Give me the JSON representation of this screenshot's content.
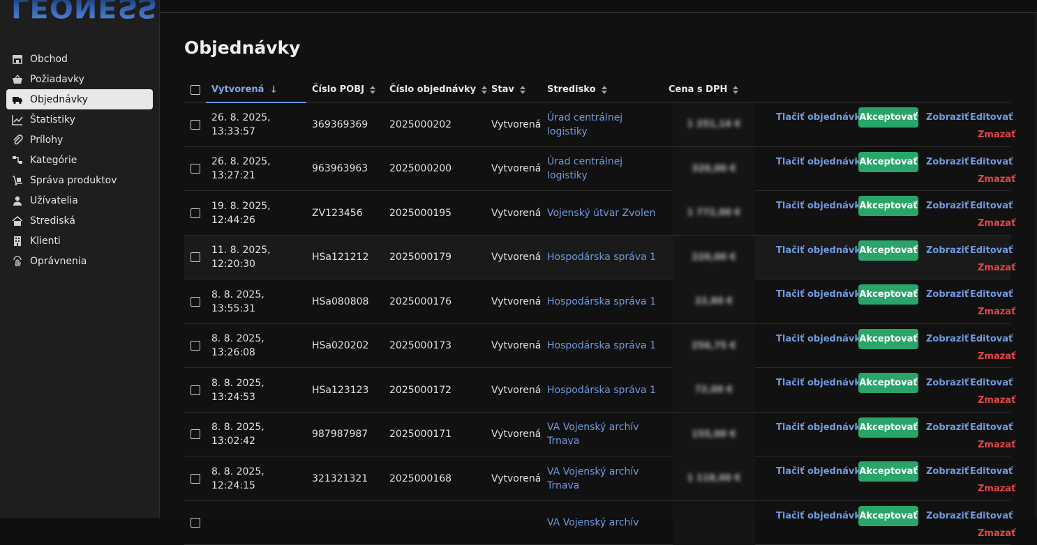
{
  "app": {
    "logo_text": "LEONESS"
  },
  "sidebar": {
    "items": [
      {
        "label": "Obchod",
        "icon": "store-icon",
        "active": false
      },
      {
        "label": "Požiadavky",
        "icon": "basket-icon",
        "active": false
      },
      {
        "label": "Objednávky",
        "icon": "truck-icon",
        "active": true
      },
      {
        "label": "Štatistiky",
        "icon": "chart-line-icon",
        "active": false
      },
      {
        "label": "Prílohy",
        "icon": "paperclip-icon",
        "active": false
      },
      {
        "label": "Kategórie",
        "icon": "sitemap-icon",
        "active": false
      },
      {
        "label": "Správa produktov",
        "icon": "dolly-icon",
        "active": false
      },
      {
        "label": "Užívatelia",
        "icon": "user-icon",
        "active": false
      },
      {
        "label": "Strediská",
        "icon": "house-user-icon",
        "active": false
      },
      {
        "label": "Klienti",
        "icon": "building-icon",
        "active": false
      },
      {
        "label": "Oprávnenia",
        "icon": "fingerprint-icon",
        "active": false
      }
    ]
  },
  "main": {
    "title": "Objednávky",
    "columns": {
      "created": "Vytvorená",
      "pobj": "Číslo POBJ",
      "order_number": "Číslo objednávky",
      "status": "Stav",
      "center": "Stredisko",
      "price": "Cena s DPH"
    },
    "actions": {
      "print": "Tlačiť objednávku",
      "accept": "Akceptovať",
      "view": "Zobraziť",
      "edit": "Editovať",
      "delete": "Zmazať"
    },
    "rows": [
      {
        "created": "26. 8. 2025, 13:33:57",
        "pobj": "369369369",
        "order_number": "2025000202",
        "status": "Vytvorená",
        "center": "Úrad centrálnej logistiky",
        "price": "1 251,14 €"
      },
      {
        "created": "26. 8. 2025, 13:27:21",
        "pobj": "963963963",
        "order_number": "2025000200",
        "status": "Vytvorená",
        "center": "Úrad centrálnej logistiky",
        "price": "320,00 €"
      },
      {
        "created": "19. 8. 2025, 12:44:26",
        "pobj": "ZV123456",
        "order_number": "2025000195",
        "status": "Vytvorená",
        "center": "Vojenský útvar Zvolen",
        "price": "1 772,00 €"
      },
      {
        "created": "11. 8. 2025, 12:20:30",
        "pobj": "HSa121212",
        "order_number": "2025000179",
        "status": "Vytvorená",
        "center": "Hospodárska správa 1",
        "price": "220,00 €"
      },
      {
        "created": "8. 8. 2025, 13:55:31",
        "pobj": "HSa080808",
        "order_number": "2025000176",
        "status": "Vytvorená",
        "center": "Hospodárska správa 1",
        "price": "22,80 €"
      },
      {
        "created": "8. 8. 2025, 13:26:08",
        "pobj": "HSa020202",
        "order_number": "2025000173",
        "status": "Vytvorená",
        "center": "Hospodárska správa 1",
        "price": "256,75 €"
      },
      {
        "created": "8. 8. 2025, 13:24:53",
        "pobj": "HSa123123",
        "order_number": "2025000172",
        "status": "Vytvorená",
        "center": "Hospodárska správa 1",
        "price": "72,00 €"
      },
      {
        "created": "8. 8. 2025, 13:02:42",
        "pobj": "987987987",
        "order_number": "2025000171",
        "status": "Vytvorená",
        "center": "VA Vojenský archív Trnava",
        "price": "155,00 €"
      },
      {
        "created": "8. 8. 2025, 12:24:15",
        "pobj": "321321321",
        "order_number": "2025000168",
        "status": "Vytvorená",
        "center": "VA Vojenský archív Trnava",
        "price": "1 118,00 €"
      },
      {
        "created": "",
        "pobj": "",
        "order_number": "",
        "status": "",
        "center": "VA Vojenský archív",
        "price": ""
      }
    ]
  },
  "colors": {
    "accent": "#6f9ae0",
    "accept_button": "#2aa56a",
    "delete": "#e04848",
    "active_nav_bg": "#e8e8e8"
  }
}
